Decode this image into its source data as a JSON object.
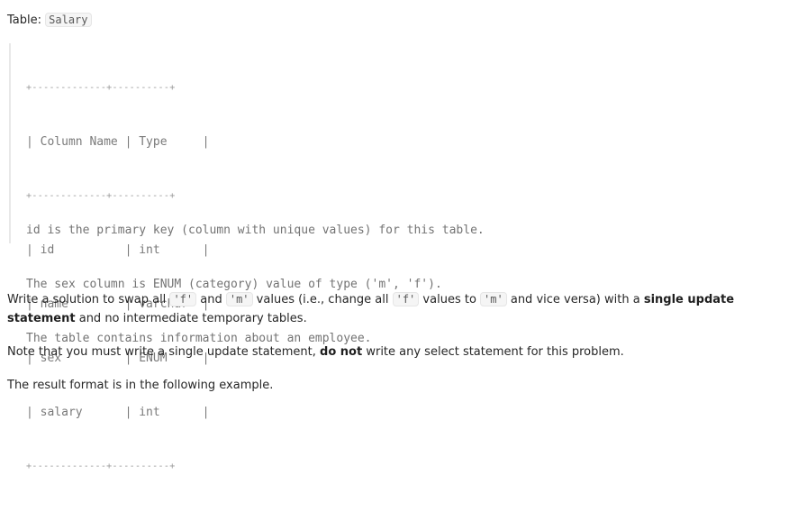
{
  "table_header": {
    "label": "Table: ",
    "table_name": "Salary"
  },
  "schema": {
    "border_top": "+-------------+----------+",
    "header_row": "| Column Name | Type     |",
    "border_mid": "+-------------+----------+",
    "rows": [
      "| id          | int      |",
      "| name        | varchar  |",
      "| sex         | ENUM     |",
      "| salary      | int      |"
    ],
    "border_bottom": "+-------------+----------+",
    "notes": [
      "id is the primary key (column with unique values) for this table.",
      "The sex column is ENUM (category) value of type ('m', 'f').",
      "The table contains information about an employee."
    ]
  },
  "description": {
    "p1": {
      "t1": "Write a solution to swap all ",
      "c1": "'f'",
      "t2": " and ",
      "c2": "'m'",
      "t3": " values (i.e., change all ",
      "c3": "'f'",
      "t4": " values to ",
      "c4": "'m'",
      "t5": " and vice versa) with a ",
      "b1": "single update statement",
      "t6": " and no intermediate temporary tables."
    },
    "p2": {
      "t1": "Note that you must write a single update statement, ",
      "b1": "do not",
      "t2": " write any select statement for this problem."
    },
    "p3": "The result format is in the following example."
  }
}
